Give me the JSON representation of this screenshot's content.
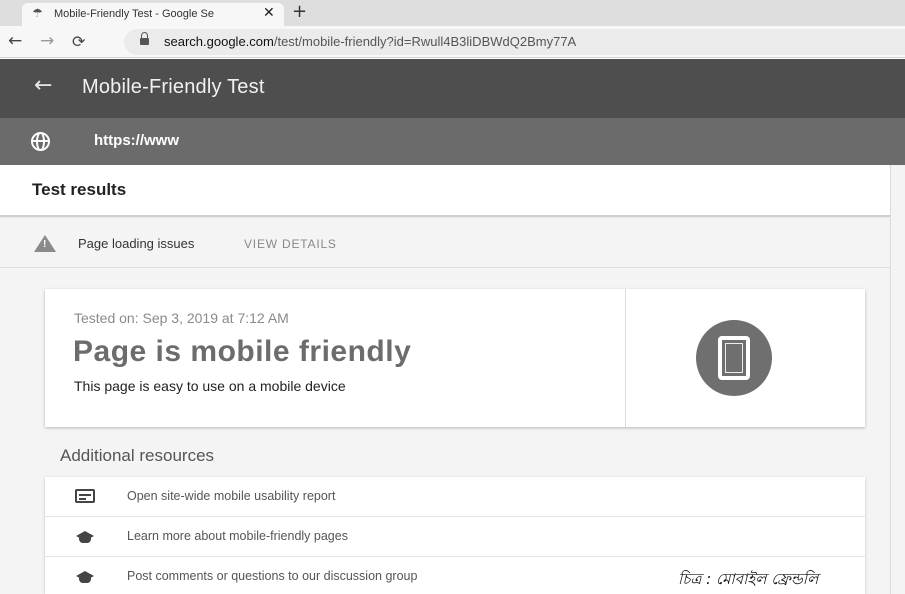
{
  "browser": {
    "tab_title": "Mobile-Friendly Test - Google Se",
    "tab_icon": "google-test-favicon",
    "close_symbol": "✕",
    "new_tab_symbol": "+",
    "url_host": "search.google.com",
    "url_path": "/test/mobile-friendly?id=Rwull4B3liDBWdQ2Bmy77A"
  },
  "app": {
    "title": "Mobile-Friendly Test",
    "tested_url": "https://www"
  },
  "results": {
    "heading": "Test results",
    "issues_label": "Page loading issues",
    "view_details": "VIEW DETAILS"
  },
  "result_card": {
    "tested_on": "Tested on: Sep 3, 2019 at 7:12 AM",
    "headline": "Page is mobile friendly",
    "subtext": "This page is easy to use on a mobile device"
  },
  "additional": {
    "title": "Additional resources",
    "items": [
      {
        "label": "Open site-wide mobile usability report",
        "icon": "report-icon"
      },
      {
        "label": "Learn more about mobile-friendly pages",
        "icon": "school-icon"
      },
      {
        "label": "Post comments or questions to our discussion group",
        "icon": "school-icon"
      }
    ]
  },
  "caption": "চিত্র : মোবাইল ফ্রেন্ডলি",
  "colors": {
    "app_header": "#4e4e4e",
    "url_bar": "#6b6b6b",
    "content_bg": "#f4f4f4"
  }
}
